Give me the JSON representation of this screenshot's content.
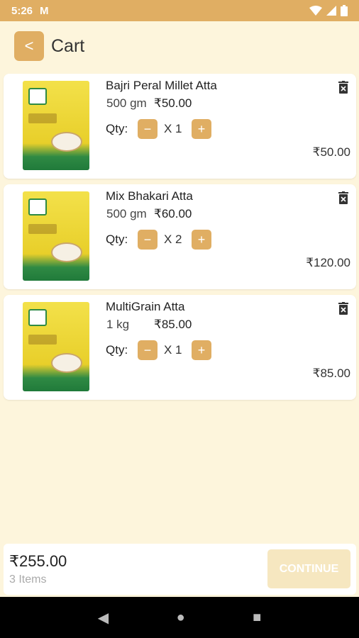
{
  "status": {
    "time": "5:26",
    "mail_icon": "M"
  },
  "header": {
    "back_icon": "<",
    "title": "Cart"
  },
  "items": [
    {
      "name": "Bajri Peral Millet Atta",
      "size": "500 gm",
      "price": "₹50.00",
      "qty_label": "Qty:",
      "qty": "X 1",
      "minus": "−",
      "plus": "+",
      "total": "₹50.00"
    },
    {
      "name": "Mix Bhakari Atta",
      "size": "500 gm",
      "price": "₹60.00",
      "qty_label": "Qty:",
      "qty": "X 2",
      "minus": "−",
      "plus": "+",
      "total": "₹120.00"
    },
    {
      "name": "MultiGrain Atta",
      "size": "1 kg",
      "price": "₹85.00",
      "qty_label": "Qty:",
      "qty": "X 1",
      "minus": "−",
      "plus": "+",
      "total": "₹85.00"
    }
  ],
  "footer": {
    "total": "₹255.00",
    "items": "3 Items",
    "continue": "CONTINUE"
  },
  "nav": {
    "back": "◀",
    "home": "●",
    "recents": "■"
  }
}
